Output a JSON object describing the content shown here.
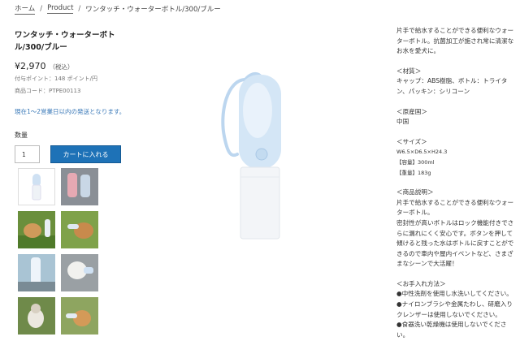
{
  "breadcrumb": {
    "home": "ホーム",
    "product": "Product",
    "current": "ワンタッチ・ウォーターボトル/300/ブルー",
    "separator": "/"
  },
  "product": {
    "title": "ワンタッチ・ウォーターボトル/300/ブルー",
    "price": "¥2,970",
    "tax_note": "（税込）",
    "points": "付与ポイント：148 ポイント/円",
    "code": "商品コード：PTPE00113",
    "shipping": "現在1〜2営業日以内の発送となります。",
    "quantity_label": "数量",
    "quantity_value": "1",
    "cart_button": "カートに入れる"
  },
  "description": {
    "intro": "片手で給水することができる便利なウォーターボトル。抗菌加工が施され常に清潔なお水を愛犬に。",
    "material_heading": "＜材質＞",
    "material": "キャップ：ABS樹脂、ボトル：トライタン、パッキン：シリコーン",
    "origin_heading": "＜原産国＞",
    "origin": "中国",
    "size_heading": "＜サイズ＞",
    "size": "W6.5×D6.5×H24.3",
    "capacity": "【容量】300ml",
    "weight": "【重量】183g",
    "details_heading": "＜商品説明＞",
    "details_1": "片手で給水することができる便利なウォーターボトル。",
    "details_2": "密封性が高いボトルはロック機能付きでさらに漏れにくく安心です。ボタンを押して傾けると残った水はボトルに戻すことができるので車内や屋内イベントなど、さまざまなシーンで大活躍！",
    "care_heading": "＜お手入れ方法＞",
    "care_1": "●中性洗剤を使用し水洗いしてください。",
    "care_2": "●ナイロンブラシや金属たわし、研磨入りクレンザーは使用しないでください。",
    "care_3": "●食器洗い乾燥機は使用しないでください。"
  },
  "colors": {
    "accent": "#1e72b7",
    "shipping_text": "#3a79b8",
    "bottle_blue": "#cfe1f3"
  },
  "icons": {
    "bottle_image": "product-bottle-image",
    "thumbnails": "product-thumbnail"
  }
}
